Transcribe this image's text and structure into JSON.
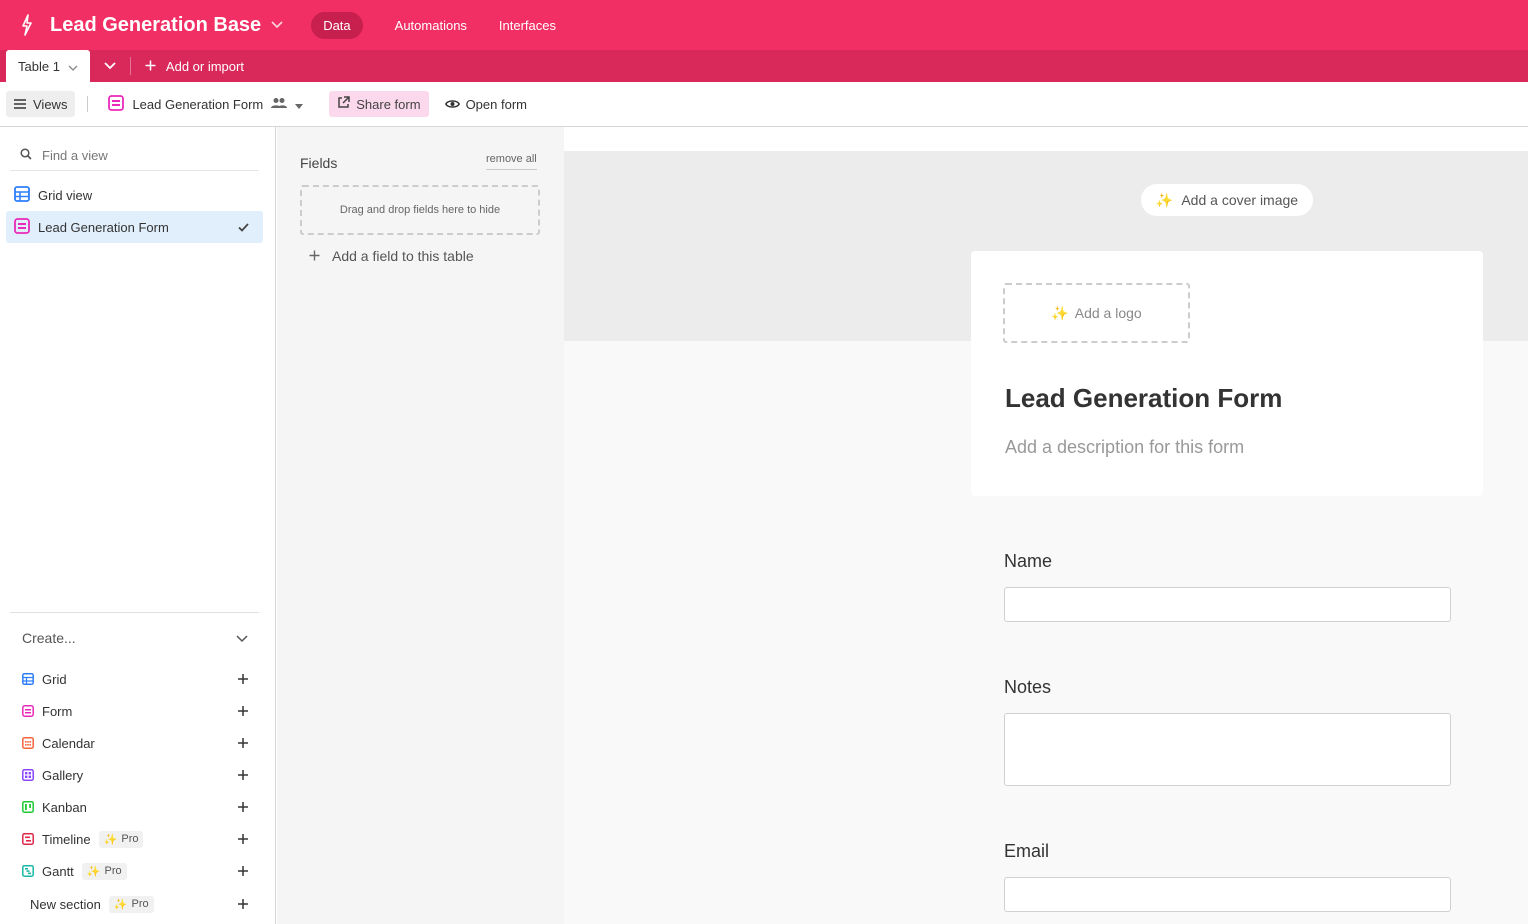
{
  "app": {
    "base_title": "Lead Generation Base",
    "nav_tabs": [
      {
        "label": "Data",
        "active": true
      },
      {
        "label": "Automations",
        "active": false
      },
      {
        "label": "Interfaces",
        "active": false
      }
    ],
    "brand_color": "#f22f64"
  },
  "tables": {
    "active_tab": "Table 1",
    "add_import_label": "Add or import"
  },
  "toolbar": {
    "views_label": "Views",
    "current_view": "Lead Generation Form",
    "share_label": "Share form",
    "open_label": "Open form"
  },
  "sidebar": {
    "search_placeholder": "Find a view",
    "views": [
      {
        "label": "Grid view",
        "icon": "grid-icon",
        "selected": false
      },
      {
        "label": "Lead Generation Form",
        "icon": "form-icon",
        "selected": true
      }
    ],
    "create_label": "Create...",
    "create_items": [
      {
        "label": "Grid",
        "icon": "grid-icon",
        "color": "#2d7ff9",
        "pro": false
      },
      {
        "label": "Form",
        "icon": "form-icon",
        "color": "#e929ba",
        "pro": false
      },
      {
        "label": "Calendar",
        "icon": "calendar-icon",
        "color": "#f7653b",
        "pro": false
      },
      {
        "label": "Gallery",
        "icon": "gallery-icon",
        "color": "#8b46ff",
        "pro": false
      },
      {
        "label": "Kanban",
        "icon": "kanban-icon",
        "color": "#20c933",
        "pro": false
      },
      {
        "label": "Timeline",
        "icon": "timeline-icon",
        "color": "#e0294a",
        "pro": true
      },
      {
        "label": "Gantt",
        "icon": "gantt-icon",
        "color": "#17b8a6",
        "pro": true
      },
      {
        "label": "New section",
        "icon": "",
        "color": "",
        "pro": true
      }
    ],
    "pro_label": "Pro"
  },
  "fields_panel": {
    "title": "Fields",
    "remove_all_label": "remove all",
    "drop_hint": "Drag and drop fields here to hide",
    "add_field_label": "Add a field to this table"
  },
  "form": {
    "cover_label": "Add a cover image",
    "logo_label": "Add a logo",
    "title": "Lead Generation Form",
    "description_placeholder": "Add a description for this form",
    "fields": [
      {
        "label": "Name"
      },
      {
        "label": "Notes"
      },
      {
        "label": "Email"
      }
    ]
  }
}
